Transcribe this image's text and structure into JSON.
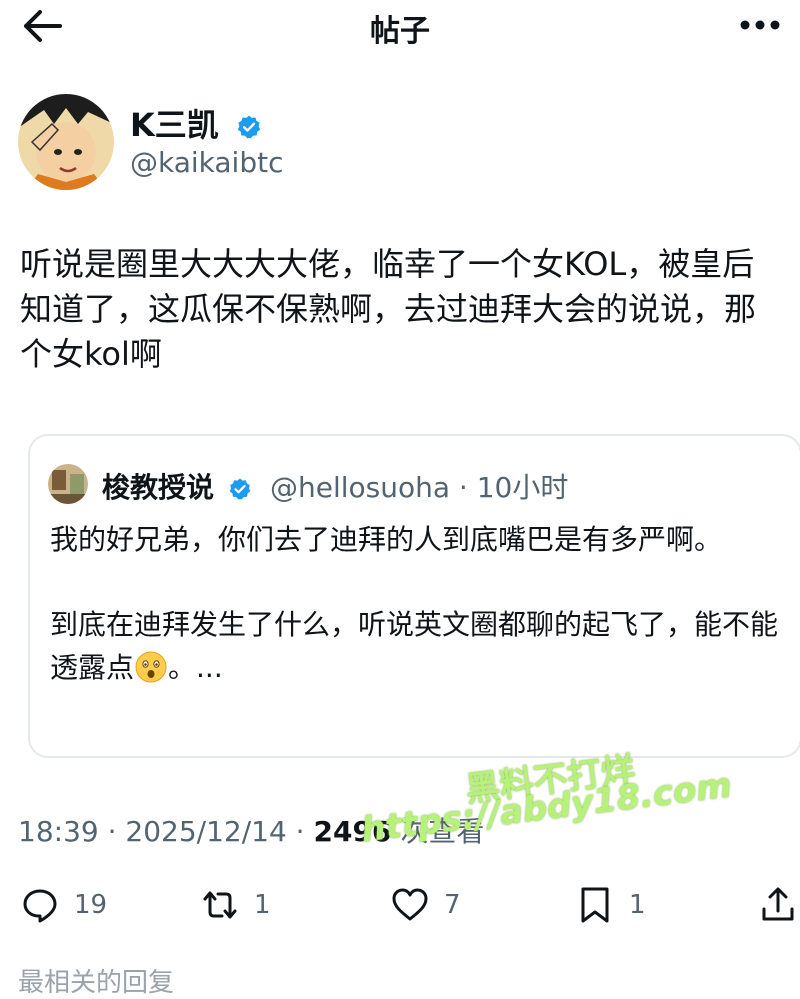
{
  "header": {
    "title": "帖子"
  },
  "author": {
    "name": "K三凯",
    "handle": "@kaikaibtc"
  },
  "post": {
    "body": "听说是圈里大大大大佬，临幸了一个女KOL，被皇后知道了，这瓜保不保熟啊，去过迪拜大会的说说，那个女kol啊"
  },
  "quote": {
    "name": "梭教授说",
    "handle": "@hellosuoha",
    "time": "10小时",
    "para1": "我的好兄弟，你们去了迪拜的人到底嘴巴是有多严啊。",
    "para2": "到底在迪拜发生了什么，听说英文圈都聊的起飞了，能不能透露点",
    "para2_tail": "。..."
  },
  "meta": {
    "time": "18:39 · 2025/12/14 · ",
    "views": "2496",
    "views_label": " 次查看"
  },
  "actions": {
    "reply_count": "19",
    "retweet_count": "1",
    "like_count": "7",
    "bookmark_count": "1"
  },
  "watermark": {
    "line1": "黑料不打烊",
    "line2": "https://abdy18.com"
  },
  "footer": {
    "cutoff_text": "最相关的回复"
  },
  "colors": {
    "verified": "#1d9bf0",
    "secondary_text": "#536471",
    "watermark": "#b6f27a"
  },
  "icons": [
    "back-arrow-icon",
    "more-icon",
    "verified-icon",
    "reply-icon",
    "retweet-icon",
    "like-icon",
    "bookmark-icon",
    "share-icon",
    "astonished-face-emoji"
  ]
}
